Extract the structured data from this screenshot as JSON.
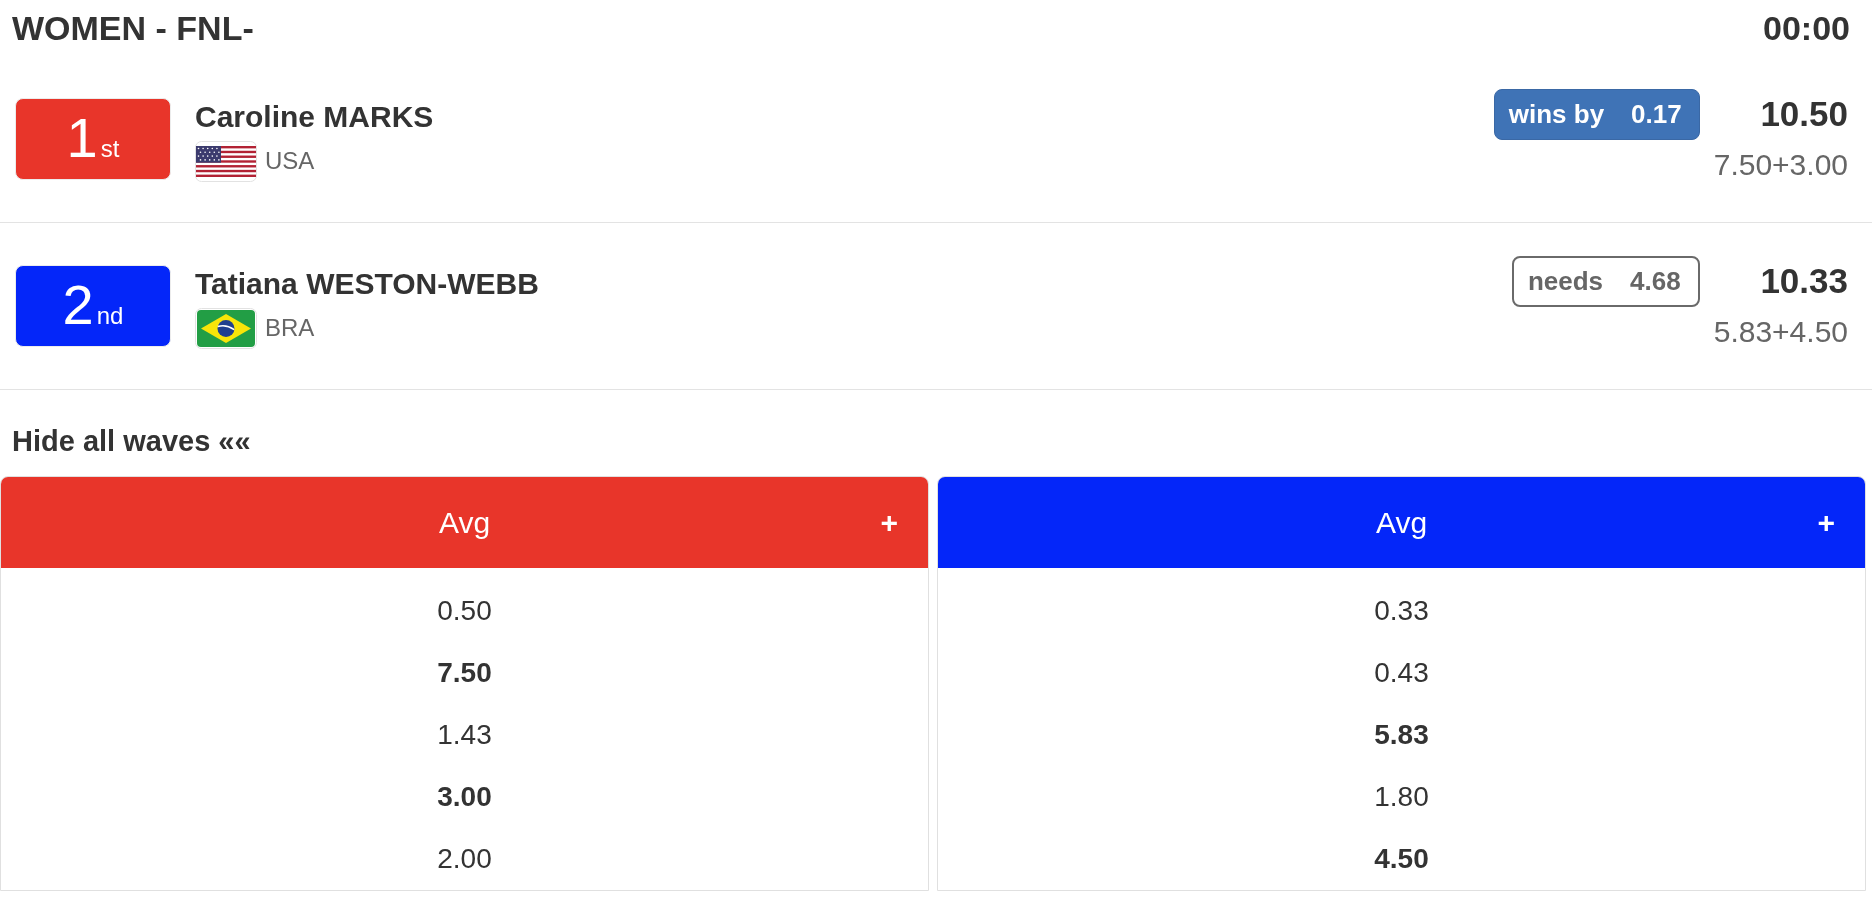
{
  "header": {
    "title": "WOMEN - FNL-",
    "timer": "00:00"
  },
  "athletes": [
    {
      "rank": "1$_{st}$",
      "color": "#e8352a",
      "name": "Caroline MARKS",
      "flag": {
        "kind": "us"
      },
      "country": "USA",
      "status": {
        "kind": "wins",
        "label": "wins by",
        "value": "0.17"
      },
      "total": "10.50",
      "breakdown": "7.50+3.00"
    },
    {
      "rank": "2$_{nd}$",
      "color": "#0426f9",
      "name": "Tatiana WESTON-WEBB",
      "flag": {
        "kind": "br"
      },
      "country": "BRA",
      "status": {
        "kind": "needs",
        "label": "needs",
        "value": "4.68"
      },
      "total": "10.33",
      "breakdown": "5.83+4.50"
    }
  ],
  "waves_toggle": "Hide all waves ««",
  "wave_panels": [
    {
      "color": "#e8352a",
      "heading": "Avg",
      "expand": "+",
      "scores": [
        {
          "value": "0.50",
          "counted": false
        },
        {
          "value": "7.50",
          "counted": true
        },
        {
          "value": "1.43",
          "counted": false
        },
        {
          "value": "3.00",
          "counted": true
        },
        {
          "value": "2.00",
          "counted": false
        }
      ]
    },
    {
      "color": "#0426f9",
      "heading": "Avg",
      "expand": "+",
      "scores": [
        {
          "value": "0.33",
          "counted": false
        },
        {
          "value": "0.43",
          "counted": false
        },
        {
          "value": "5.83",
          "counted": true
        },
        {
          "value": "1.80",
          "counted": false
        },
        {
          "value": "4.50",
          "counted": true
        }
      ]
    }
  ]
}
